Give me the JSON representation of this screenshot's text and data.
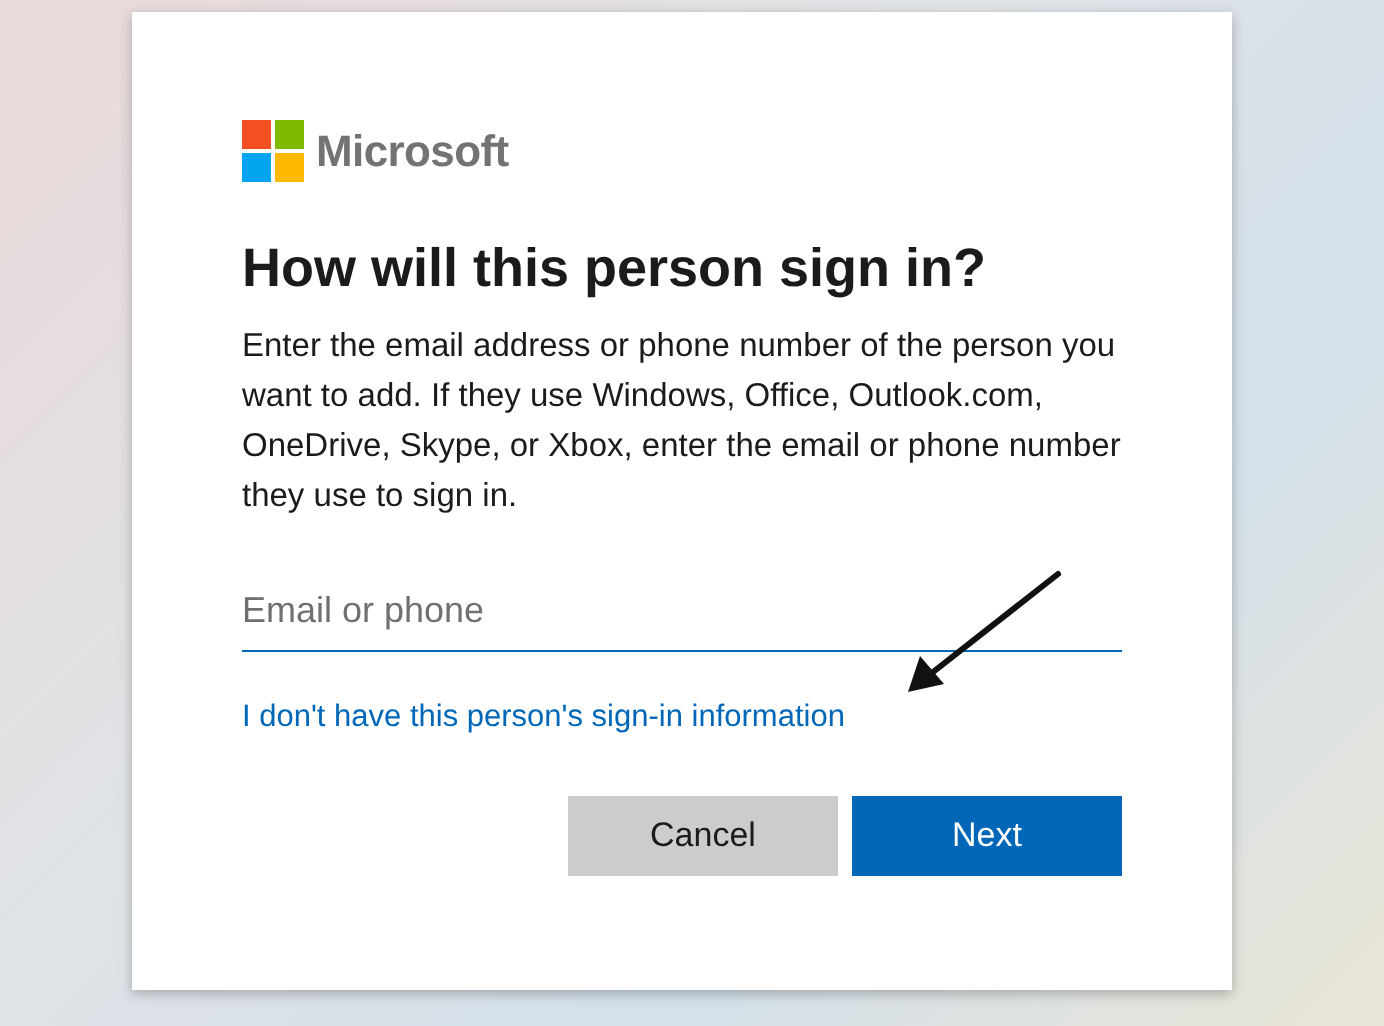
{
  "logo": {
    "text": "Microsoft"
  },
  "dialog": {
    "title": "How will this person sign in?",
    "description": "Enter the email address or phone number of the person you want to add. If they use Windows, Office, Outlook.com, OneDrive, Skype, or Xbox, enter the email or phone number they use to sign in.",
    "field": {
      "placeholder": "Email or phone"
    },
    "link": "I don't have this person's sign-in information",
    "buttons": [
      {
        "label": "Cancel",
        "kind": "secondary"
      },
      {
        "label": "Next",
        "kind": "primary"
      }
    ]
  }
}
